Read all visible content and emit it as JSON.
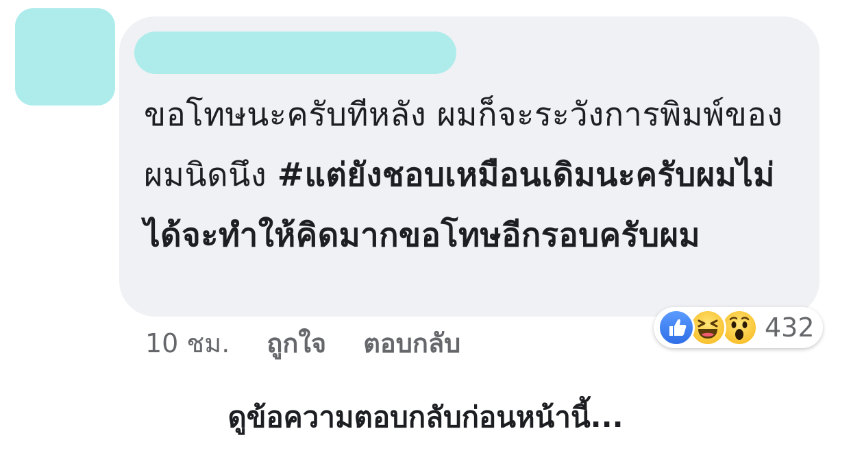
{
  "comment": {
    "text_regular": "ขอโทษนะครับทีหลัง ผมก็จะระวังการพิมพ์ของผมนิดนึง ",
    "text_bold": "#แต่ยังชอบเหมือนเดิมนะครับผมไม่ได้จะทำให้คิดมากขอโทษอีกรอบครับผม"
  },
  "reactions": {
    "icons": [
      "like-icon",
      "haha-icon",
      "wow-icon"
    ],
    "count": "432",
    "colors": {
      "like": "#3b82f6",
      "emoji": "#f7b515"
    }
  },
  "meta": {
    "time": "10 ชม.",
    "like_label": "ถูกใจ",
    "reply_label": "ตอบกลับ"
  },
  "view_previous": "ดูข้อความตอบกลับก่อนหน้านี้..."
}
